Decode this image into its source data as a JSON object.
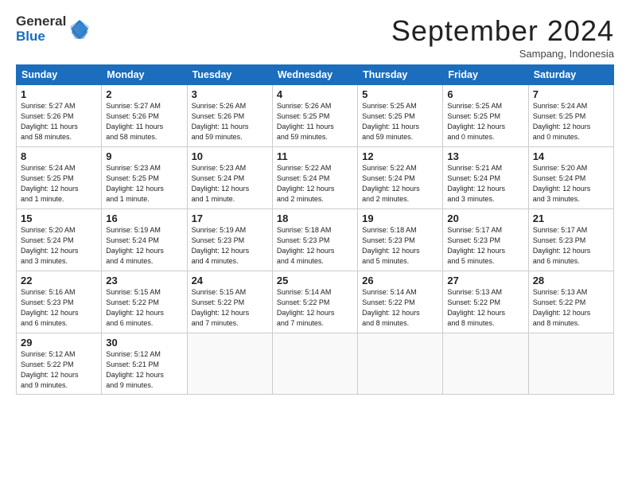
{
  "logo": {
    "general": "General",
    "blue": "Blue"
  },
  "header": {
    "month": "September 2024",
    "location": "Sampang, Indonesia"
  },
  "weekdays": [
    "Sunday",
    "Monday",
    "Tuesday",
    "Wednesday",
    "Thursday",
    "Friday",
    "Saturday"
  ],
  "weeks": [
    [
      {
        "day": "1",
        "info": "Sunrise: 5:27 AM\nSunset: 5:26 PM\nDaylight: 11 hours\nand 58 minutes."
      },
      {
        "day": "2",
        "info": "Sunrise: 5:27 AM\nSunset: 5:26 PM\nDaylight: 11 hours\nand 58 minutes."
      },
      {
        "day": "3",
        "info": "Sunrise: 5:26 AM\nSunset: 5:26 PM\nDaylight: 11 hours\nand 59 minutes."
      },
      {
        "day": "4",
        "info": "Sunrise: 5:26 AM\nSunset: 5:25 PM\nDaylight: 11 hours\nand 59 minutes."
      },
      {
        "day": "5",
        "info": "Sunrise: 5:25 AM\nSunset: 5:25 PM\nDaylight: 11 hours\nand 59 minutes."
      },
      {
        "day": "6",
        "info": "Sunrise: 5:25 AM\nSunset: 5:25 PM\nDaylight: 12 hours\nand 0 minutes."
      },
      {
        "day": "7",
        "info": "Sunrise: 5:24 AM\nSunset: 5:25 PM\nDaylight: 12 hours\nand 0 minutes."
      }
    ],
    [
      {
        "day": "8",
        "info": "Sunrise: 5:24 AM\nSunset: 5:25 PM\nDaylight: 12 hours\nand 1 minute."
      },
      {
        "day": "9",
        "info": "Sunrise: 5:23 AM\nSunset: 5:25 PM\nDaylight: 12 hours\nand 1 minute."
      },
      {
        "day": "10",
        "info": "Sunrise: 5:23 AM\nSunset: 5:24 PM\nDaylight: 12 hours\nand 1 minute."
      },
      {
        "day": "11",
        "info": "Sunrise: 5:22 AM\nSunset: 5:24 PM\nDaylight: 12 hours\nand 2 minutes."
      },
      {
        "day": "12",
        "info": "Sunrise: 5:22 AM\nSunset: 5:24 PM\nDaylight: 12 hours\nand 2 minutes."
      },
      {
        "day": "13",
        "info": "Sunrise: 5:21 AM\nSunset: 5:24 PM\nDaylight: 12 hours\nand 3 minutes."
      },
      {
        "day": "14",
        "info": "Sunrise: 5:20 AM\nSunset: 5:24 PM\nDaylight: 12 hours\nand 3 minutes."
      }
    ],
    [
      {
        "day": "15",
        "info": "Sunrise: 5:20 AM\nSunset: 5:24 PM\nDaylight: 12 hours\nand 3 minutes."
      },
      {
        "day": "16",
        "info": "Sunrise: 5:19 AM\nSunset: 5:24 PM\nDaylight: 12 hours\nand 4 minutes."
      },
      {
        "day": "17",
        "info": "Sunrise: 5:19 AM\nSunset: 5:23 PM\nDaylight: 12 hours\nand 4 minutes."
      },
      {
        "day": "18",
        "info": "Sunrise: 5:18 AM\nSunset: 5:23 PM\nDaylight: 12 hours\nand 4 minutes."
      },
      {
        "day": "19",
        "info": "Sunrise: 5:18 AM\nSunset: 5:23 PM\nDaylight: 12 hours\nand 5 minutes."
      },
      {
        "day": "20",
        "info": "Sunrise: 5:17 AM\nSunset: 5:23 PM\nDaylight: 12 hours\nand 5 minutes."
      },
      {
        "day": "21",
        "info": "Sunrise: 5:17 AM\nSunset: 5:23 PM\nDaylight: 12 hours\nand 6 minutes."
      }
    ],
    [
      {
        "day": "22",
        "info": "Sunrise: 5:16 AM\nSunset: 5:23 PM\nDaylight: 12 hours\nand 6 minutes."
      },
      {
        "day": "23",
        "info": "Sunrise: 5:15 AM\nSunset: 5:22 PM\nDaylight: 12 hours\nand 6 minutes."
      },
      {
        "day": "24",
        "info": "Sunrise: 5:15 AM\nSunset: 5:22 PM\nDaylight: 12 hours\nand 7 minutes."
      },
      {
        "day": "25",
        "info": "Sunrise: 5:14 AM\nSunset: 5:22 PM\nDaylight: 12 hours\nand 7 minutes."
      },
      {
        "day": "26",
        "info": "Sunrise: 5:14 AM\nSunset: 5:22 PM\nDaylight: 12 hours\nand 8 minutes."
      },
      {
        "day": "27",
        "info": "Sunrise: 5:13 AM\nSunset: 5:22 PM\nDaylight: 12 hours\nand 8 minutes."
      },
      {
        "day": "28",
        "info": "Sunrise: 5:13 AM\nSunset: 5:22 PM\nDaylight: 12 hours\nand 8 minutes."
      }
    ],
    [
      {
        "day": "29",
        "info": "Sunrise: 5:12 AM\nSunset: 5:22 PM\nDaylight: 12 hours\nand 9 minutes."
      },
      {
        "day": "30",
        "info": "Sunrise: 5:12 AM\nSunset: 5:21 PM\nDaylight: 12 hours\nand 9 minutes."
      },
      {
        "day": "",
        "info": ""
      },
      {
        "day": "",
        "info": ""
      },
      {
        "day": "",
        "info": ""
      },
      {
        "day": "",
        "info": ""
      },
      {
        "day": "",
        "info": ""
      }
    ]
  ]
}
